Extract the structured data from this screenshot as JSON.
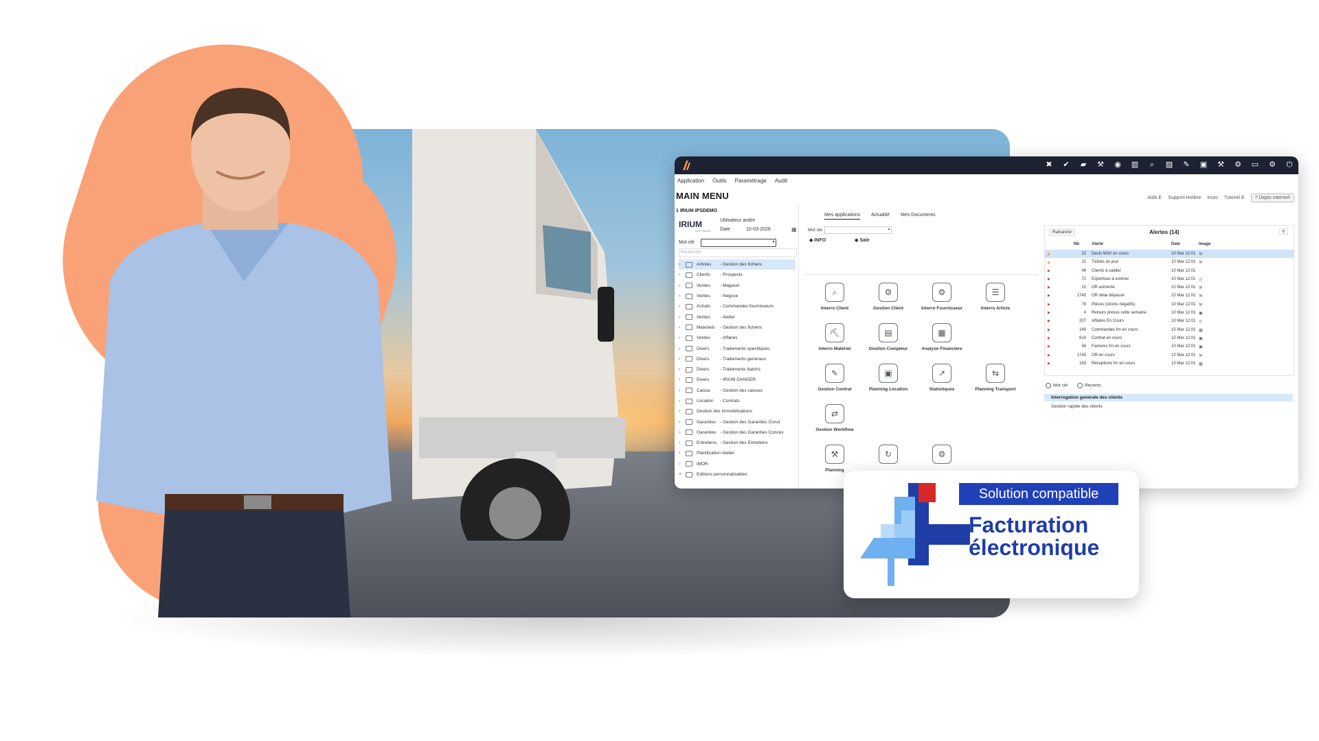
{
  "app": {
    "menu": [
      "Application",
      "Outils",
      "Paramétrage",
      "Audit"
    ],
    "main_title": "MAIN MENU",
    "top_links": [
      "Aide E",
      "Support Hotline",
      "Irium",
      "Tutoriel E"
    ],
    "demo_button": "? Deplu interneh",
    "company": "1 IRIUM IPSDEMO",
    "logo_text": "IRIUM",
    "logo_sub": "SOFTWARE",
    "user_line": "Utilisateur andre",
    "date_label": "Date",
    "date_value": "10-03-2026",
    "motcle_label": "Mot clé",
    "search_placeholder": "Recherche",
    "tree": [
      {
        "cat": "Articles",
        "label": "- Gestion des fichiers"
      },
      {
        "cat": "Clients",
        "label": "- Prospects"
      },
      {
        "cat": "Ventes",
        "label": "- Magasin"
      },
      {
        "cat": "Ventes",
        "label": "- Negoce"
      },
      {
        "cat": "Achats",
        "label": "- Commandes fournisseurs"
      },
      {
        "cat": "Ventes",
        "label": "- Atelier"
      },
      {
        "cat": "Materiels",
        "label": "- Gestion des fichiers"
      },
      {
        "cat": "Ventes",
        "label": "- Affaires"
      },
      {
        "cat": "Divers",
        "label": "- Traitements specifiques"
      },
      {
        "cat": "Divers",
        "label": "- Traitements generaux"
      },
      {
        "cat": "Divers",
        "label": "- Traitements batchs"
      },
      {
        "cat": "Divers",
        "label": "- IRIUM DANGER"
      },
      {
        "cat": "Caisse",
        "label": "- Gestion des caisses"
      },
      {
        "cat": "Location",
        "label": "- Contrats"
      },
      {
        "cat": "",
        "label": "Gestion des immobilisations"
      },
      {
        "cat": "Garanties",
        "label": "- Gestion des Garanties Const"
      },
      {
        "cat": "Garanties",
        "label": "- Gestion des Garanties Conces"
      },
      {
        "cat": "Entretiens",
        "label": "- Gestion des Entretiens"
      },
      {
        "cat": "",
        "label": "Planification Atelier"
      },
      {
        "cat": "",
        "label": "iMOR"
      },
      {
        "cat": "",
        "label": "Editions personnalisables"
      }
    ],
    "center_tabs": [
      "Mes applications",
      "Actualité",
      "Mes Documents"
    ],
    "center_motcle": "Mot clé",
    "chip_info": "INFO",
    "chip_sale": "Sale",
    "apps": [
      {
        "label": "Interro Client",
        "icon": "magnifier-user-icon",
        "glyph": "⌕"
      },
      {
        "label": "Gestion Client",
        "icon": "magnifier-gear-icon",
        "glyph": "⚙"
      },
      {
        "label": "Interro Fournisseur",
        "icon": "gears-icon",
        "glyph": "⚙"
      },
      {
        "label": "Interro Article",
        "icon": "flow-icon",
        "glyph": "☰"
      },
      {
        "label": "Interro Matériel",
        "icon": "excavator-icon",
        "glyph": "⛏"
      },
      {
        "label": "Gestion Compteur",
        "icon": "counter-icon",
        "glyph": "▤"
      },
      {
        "label": "Analyse Financière",
        "icon": "report-icon",
        "glyph": "▦"
      },
      {
        "label": "",
        "icon": "",
        "glyph": ""
      },
      {
        "label": "Gestion Contrat",
        "icon": "contract-icon",
        "glyph": "✎"
      },
      {
        "label": "Planning Location",
        "icon": "calendar-tools-icon",
        "glyph": "▣"
      },
      {
        "label": "Statistiques",
        "icon": "stats-icon",
        "glyph": "↗"
      },
      {
        "label": "Planning Transport",
        "icon": "transport-icon",
        "glyph": "⇆"
      },
      {
        "label": "Gestion Workflow",
        "icon": "workflow-icon",
        "glyph": "⇄"
      },
      {
        "label": "",
        "icon": "",
        "glyph": ""
      },
      {
        "label": "",
        "icon": "",
        "glyph": ""
      },
      {
        "label": "",
        "icon": "",
        "glyph": ""
      },
      {
        "label": "Planning",
        "icon": "planning-icon",
        "glyph": "⚒"
      },
      {
        "label": "",
        "icon": "refresh-app-icon",
        "glyph": "↻"
      },
      {
        "label": "",
        "icon": "tools-icon",
        "glyph": "⚙"
      }
    ],
    "alerts": {
      "refresh": "Rafraîchir",
      "title": "Alertes (14)",
      "headers": {
        "nb": "Nb",
        "alerte": "Alerte",
        "date": "Date",
        "image": "Image"
      },
      "rows": [
        {
          "nb": "22",
          "text": "Devis MAV en cours",
          "date": "10 Mar 12:01",
          "warn": true
        },
        {
          "nb": "22",
          "text": "Tickets du jour",
          "date": "10 Mar 12:01",
          "warn": true
        },
        {
          "nb": "46",
          "text": "Clients à valider",
          "date": "10 Mar 12:01",
          "warn": false
        },
        {
          "nb": "72",
          "text": "Expertises à estimer",
          "date": "10 Mar 12:01",
          "warn": false
        },
        {
          "nb": "22",
          "text": "OR astreinte",
          "date": "10 Mar 12:01",
          "warn": false
        },
        {
          "nb": "1745",
          "text": "OR délai dépassé",
          "date": "10 Mar 12:01",
          "warn": false
        },
        {
          "nb": "78",
          "text": "Pièces (stocks négatifs)",
          "date": "10 Mar 12:01",
          "warn": false
        },
        {
          "nb": "4",
          "text": "Retours prevus cette semaine",
          "date": "10 Mar 12:01",
          "warn": false
        },
        {
          "nb": "207",
          "text": "Affaires En Cours",
          "date": "10 Mar 12:01",
          "warn": false
        },
        {
          "nb": "149",
          "text": "Commandes frn en cours",
          "date": "10 Mar 12:01",
          "warn": false
        },
        {
          "nb": "814",
          "text": "Contrat en cours",
          "date": "10 Mar 12:01",
          "warn": false
        },
        {
          "nb": "56",
          "text": "Factures frn en cours",
          "date": "10 Mar 12:01",
          "warn": false
        },
        {
          "nb": "1745",
          "text": "OR en cours",
          "date": "10 Mar 12:01",
          "warn": false
        },
        {
          "nb": "163",
          "text": "Réceptions frn en cours",
          "date": "10 Mar 12:01",
          "warn": false
        }
      ]
    },
    "radio_motcle": "Mot clé",
    "radio_recents": "Récents",
    "query1": "Interrogation generale des clients",
    "query2": "Gestion rapide des clients"
  },
  "badge": {
    "chip": "Solution compatible",
    "line1": "Facturation",
    "line2": "électronique"
  },
  "colors": {
    "accent_orange": "#f9a278",
    "app_topbar": "#1d2233",
    "badge_blue": "#2040b8",
    "badge_text": "#1f3ea8",
    "badge_red": "#d62828"
  }
}
